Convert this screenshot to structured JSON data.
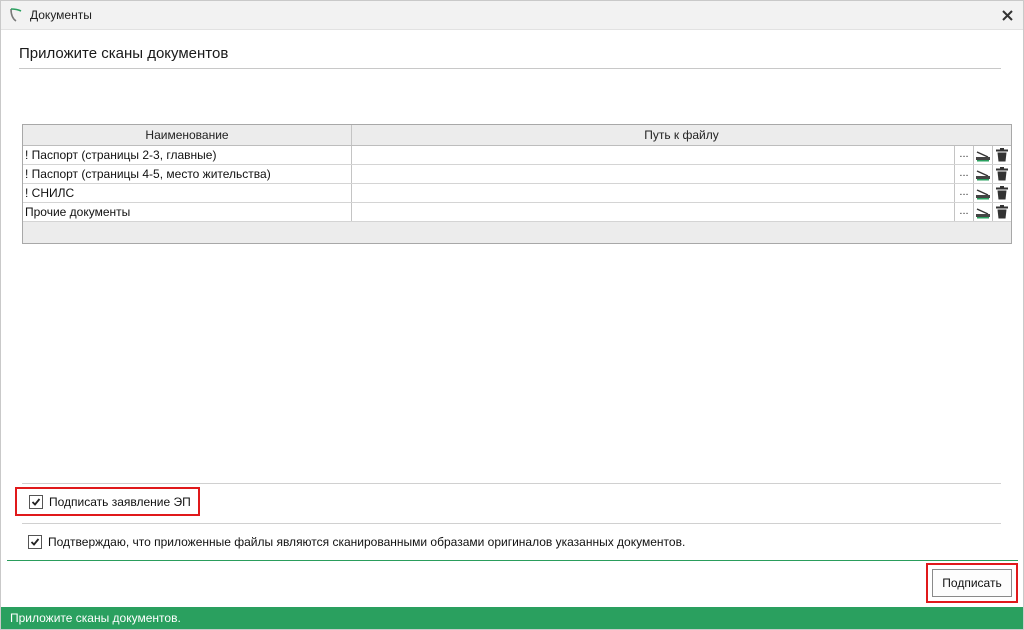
{
  "window": {
    "title": "Документы"
  },
  "heading": "Приложите сканы документов",
  "table": {
    "columns": [
      "Наименование",
      "Путь к файлу"
    ],
    "rows": [
      {
        "name": "! Паспорт (страницы 2-3, главные)",
        "path": "",
        "browse": "..."
      },
      {
        "name": "! Паспорт (страницы 4-5, место жительства)",
        "path": "",
        "browse": "..."
      },
      {
        "name": "! СНИЛС",
        "path": "",
        "browse": "..."
      },
      {
        "name": "Прочие документы",
        "path": "",
        "browse": "..."
      }
    ]
  },
  "checkboxes": {
    "sign_ep": {
      "label": "Подписать заявление ЭП",
      "checked": true
    },
    "confirm": {
      "label": "Подтверждаю, что приложенные файлы являются сканированными образами оригиналов указанных документов.",
      "checked": true
    }
  },
  "buttons": {
    "sign": "Подписать"
  },
  "status": "Приложите сканы документов.",
  "colors": {
    "accent_green": "#2aa05f",
    "highlight_red": "#e0191b"
  },
  "icons": {
    "app": "app-shield-icon",
    "close": "close-icon",
    "scan": "scanner-icon",
    "delete": "trash-icon",
    "check": "checkmark-icon"
  }
}
